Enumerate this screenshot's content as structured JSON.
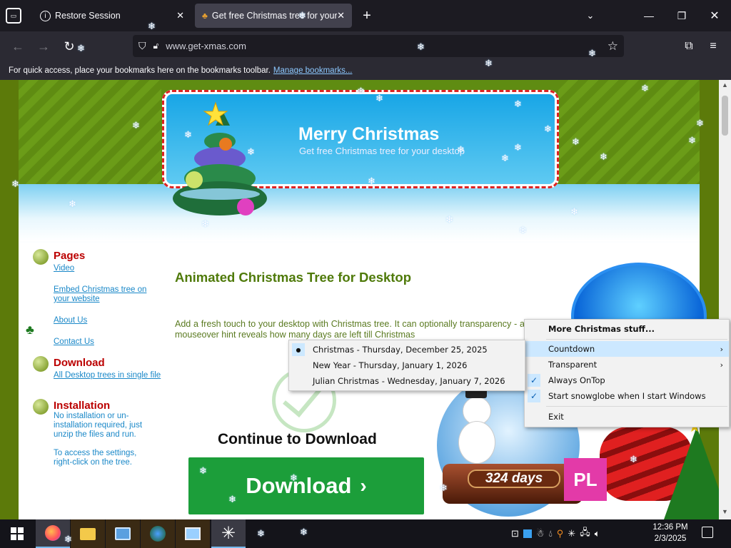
{
  "browser": {
    "tabs": [
      {
        "title": "Restore Session",
        "active": false
      },
      {
        "title": "Get free Christmas tree for your",
        "active": true
      }
    ],
    "url": "www.get-xmas.com",
    "bookmarks_hint": "For quick access, place your bookmarks here on the bookmarks toolbar.",
    "manage_bookmarks": "Manage bookmarks..."
  },
  "site": {
    "banner_title": "Merry Christmas",
    "banner_subtitle": "Get free Christmas tree for your desktop",
    "sidebar": {
      "pages_heading": "Pages",
      "pages_links": [
        "Video",
        "Embed Christmas tree on your website",
        "About Us",
        "Contact Us"
      ],
      "download_heading": "Download",
      "download_link": "All Desktop trees in single file",
      "install_heading": "Installation",
      "install_text": "No installation or un-installation required, just unzip the files and run.",
      "install_settings": "To access the settings, right-click on the tree."
    },
    "heading": "Animated Christmas Tree for Desktop",
    "description": "Add a fresh touch to your desktop with Christmas tree. It can optionally transparency - a mouseover hint reveals how many days are left till Christmas",
    "continue": "Continue to Download",
    "download_button": "Download",
    "countdown_badge": "324 days"
  },
  "context_menu": {
    "items": [
      "More Christmas stuff...",
      "Countdown",
      "Transparent",
      "Always OnTop",
      "Start snowglobe when I start Windows",
      "Exit"
    ],
    "checked": [
      "Always OnTop",
      "Start snowglobe when I start Windows"
    ],
    "highlighted": "Countdown"
  },
  "countdown_submenu": {
    "items": [
      "Christmas - Thursday, December 25, 2025",
      "New Year - Thursday, January 1, 2026",
      "Julian Christmas - Wednesday, January 7, 2026"
    ],
    "selected": "Christmas - Thursday, December 25, 2025"
  },
  "taskbar": {
    "time": "12:36 PM",
    "date": "2/3/2025"
  },
  "colors": {
    "accent": "#1c9e3a",
    "heading": "#4f7a0a",
    "link": "#1a88c8",
    "sidebar_heading": "#bb0000"
  }
}
